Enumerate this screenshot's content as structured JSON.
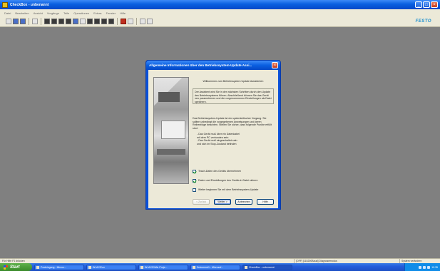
{
  "window": {
    "title": "CheckBox - unbenannt",
    "controls": {
      "minimize": "_",
      "maximize": "□",
      "close": "×"
    }
  },
  "menu": [
    "Datei",
    "Bearbeiten",
    "Ansicht",
    "Vorgänge",
    "Teile",
    "Operationen",
    "Extras",
    "Fenster",
    "Hilfe"
  ],
  "brand": "FESTO",
  "status": {
    "left": "Für Hilfe F1 drücken",
    "pane1": "[OFF] [115200Baud] Diagnosemodus",
    "pane2": "System verändern"
  },
  "dialog": {
    "title": "Allgemeine Informationen über den Betriebssystem-Update Assi...",
    "close": "×",
    "welcome": "Willkommen zum Betriebssystem Update Assistenten",
    "intro": "Der Assistent wird Sie in den nächsten Schritten durch den Update des Betriebssystems führen. Abschließend können Sie das Gerät neu parametrieren und die vorgenommenen Einstellungen als Datei speichern.",
    "warning": "Das Betriebssystem-Update ist ein systemkritischer Vorgang. Sie sollten unbedingt die vorgegebenen Anweisungen und deren Reihenfolge beachten. Stellen Sie sicher, dass folgende Punkte erfüllt sind:",
    "bullets": [
      "- Das Gerät muß über ein Datenkabel",
      "  mit dem PC verbunden sein",
      "- Das Gerät muß eingeschaltet sein",
      "  und sich im Stop-Zustand befinden"
    ],
    "checkboxes": [
      {
        "label": "Teach-Daten des Geräts übernehmen",
        "checked": true
      },
      {
        "label": "Daten und Einstellungen des Geräts in Datei sichern",
        "checked": true
      },
      {
        "label": "Weiter beginnen Sie mit dem Betriebssystem-Update",
        "checked": false
      }
    ],
    "buttons": {
      "back": "< Zurück",
      "next": "Weiter >",
      "cancel": "Abbrechen",
      "help": "Hilfe"
    }
  },
  "taskbar": {
    "start": "Start",
    "tasks": [
      "Posteingang - Micros...",
      "W:\\ACS\\xx",
      "W:\\ACS\\Wie Proje...",
      "Dokument1 - Microsof...",
      "CheckBox - unbenannt"
    ],
    "clock": "10:35"
  }
}
